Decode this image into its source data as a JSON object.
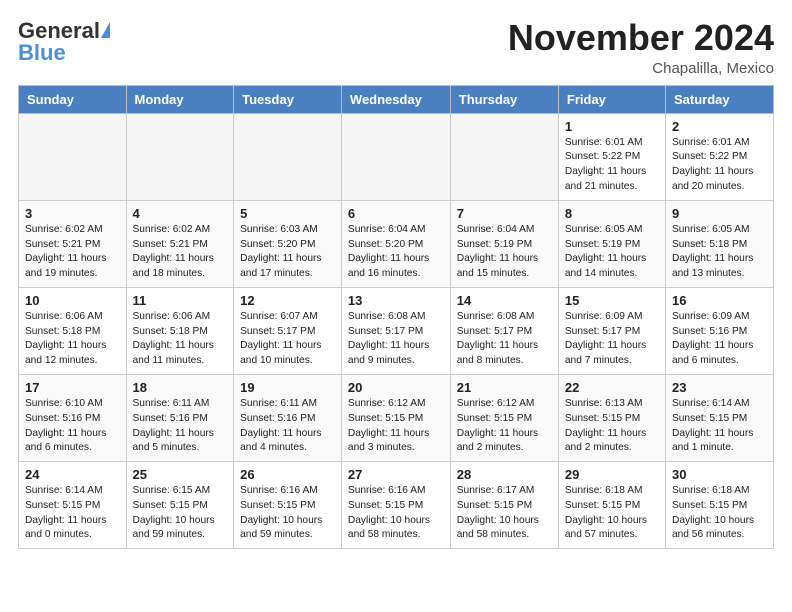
{
  "logo": {
    "general": "General",
    "blue": "Blue"
  },
  "header": {
    "month": "November 2024",
    "location": "Chapalilla, Mexico"
  },
  "weekdays": [
    "Sunday",
    "Monday",
    "Tuesday",
    "Wednesday",
    "Thursday",
    "Friday",
    "Saturday"
  ],
  "weeks": [
    [
      {
        "day": "",
        "info": ""
      },
      {
        "day": "",
        "info": ""
      },
      {
        "day": "",
        "info": ""
      },
      {
        "day": "",
        "info": ""
      },
      {
        "day": "",
        "info": ""
      },
      {
        "day": "1",
        "info": "Sunrise: 6:01 AM\nSunset: 5:22 PM\nDaylight: 11 hours\nand 21 minutes."
      },
      {
        "day": "2",
        "info": "Sunrise: 6:01 AM\nSunset: 5:22 PM\nDaylight: 11 hours\nand 20 minutes."
      }
    ],
    [
      {
        "day": "3",
        "info": "Sunrise: 6:02 AM\nSunset: 5:21 PM\nDaylight: 11 hours\nand 19 minutes."
      },
      {
        "day": "4",
        "info": "Sunrise: 6:02 AM\nSunset: 5:21 PM\nDaylight: 11 hours\nand 18 minutes."
      },
      {
        "day": "5",
        "info": "Sunrise: 6:03 AM\nSunset: 5:20 PM\nDaylight: 11 hours\nand 17 minutes."
      },
      {
        "day": "6",
        "info": "Sunrise: 6:04 AM\nSunset: 5:20 PM\nDaylight: 11 hours\nand 16 minutes."
      },
      {
        "day": "7",
        "info": "Sunrise: 6:04 AM\nSunset: 5:19 PM\nDaylight: 11 hours\nand 15 minutes."
      },
      {
        "day": "8",
        "info": "Sunrise: 6:05 AM\nSunset: 5:19 PM\nDaylight: 11 hours\nand 14 minutes."
      },
      {
        "day": "9",
        "info": "Sunrise: 6:05 AM\nSunset: 5:18 PM\nDaylight: 11 hours\nand 13 minutes."
      }
    ],
    [
      {
        "day": "10",
        "info": "Sunrise: 6:06 AM\nSunset: 5:18 PM\nDaylight: 11 hours\nand 12 minutes."
      },
      {
        "day": "11",
        "info": "Sunrise: 6:06 AM\nSunset: 5:18 PM\nDaylight: 11 hours\nand 11 minutes."
      },
      {
        "day": "12",
        "info": "Sunrise: 6:07 AM\nSunset: 5:17 PM\nDaylight: 11 hours\nand 10 minutes."
      },
      {
        "day": "13",
        "info": "Sunrise: 6:08 AM\nSunset: 5:17 PM\nDaylight: 11 hours\nand 9 minutes."
      },
      {
        "day": "14",
        "info": "Sunrise: 6:08 AM\nSunset: 5:17 PM\nDaylight: 11 hours\nand 8 minutes."
      },
      {
        "day": "15",
        "info": "Sunrise: 6:09 AM\nSunset: 5:17 PM\nDaylight: 11 hours\nand 7 minutes."
      },
      {
        "day": "16",
        "info": "Sunrise: 6:09 AM\nSunset: 5:16 PM\nDaylight: 11 hours\nand 6 minutes."
      }
    ],
    [
      {
        "day": "17",
        "info": "Sunrise: 6:10 AM\nSunset: 5:16 PM\nDaylight: 11 hours\nand 6 minutes."
      },
      {
        "day": "18",
        "info": "Sunrise: 6:11 AM\nSunset: 5:16 PM\nDaylight: 11 hours\nand 5 minutes."
      },
      {
        "day": "19",
        "info": "Sunrise: 6:11 AM\nSunset: 5:16 PM\nDaylight: 11 hours\nand 4 minutes."
      },
      {
        "day": "20",
        "info": "Sunrise: 6:12 AM\nSunset: 5:15 PM\nDaylight: 11 hours\nand 3 minutes."
      },
      {
        "day": "21",
        "info": "Sunrise: 6:12 AM\nSunset: 5:15 PM\nDaylight: 11 hours\nand 2 minutes."
      },
      {
        "day": "22",
        "info": "Sunrise: 6:13 AM\nSunset: 5:15 PM\nDaylight: 11 hours\nand 2 minutes."
      },
      {
        "day": "23",
        "info": "Sunrise: 6:14 AM\nSunset: 5:15 PM\nDaylight: 11 hours\nand 1 minute."
      }
    ],
    [
      {
        "day": "24",
        "info": "Sunrise: 6:14 AM\nSunset: 5:15 PM\nDaylight: 11 hours\nand 0 minutes."
      },
      {
        "day": "25",
        "info": "Sunrise: 6:15 AM\nSunset: 5:15 PM\nDaylight: 10 hours\nand 59 minutes."
      },
      {
        "day": "26",
        "info": "Sunrise: 6:16 AM\nSunset: 5:15 PM\nDaylight: 10 hours\nand 59 minutes."
      },
      {
        "day": "27",
        "info": "Sunrise: 6:16 AM\nSunset: 5:15 PM\nDaylight: 10 hours\nand 58 minutes."
      },
      {
        "day": "28",
        "info": "Sunrise: 6:17 AM\nSunset: 5:15 PM\nDaylight: 10 hours\nand 58 minutes."
      },
      {
        "day": "29",
        "info": "Sunrise: 6:18 AM\nSunset: 5:15 PM\nDaylight: 10 hours\nand 57 minutes."
      },
      {
        "day": "30",
        "info": "Sunrise: 6:18 AM\nSunset: 5:15 PM\nDaylight: 10 hours\nand 56 minutes."
      }
    ]
  ]
}
